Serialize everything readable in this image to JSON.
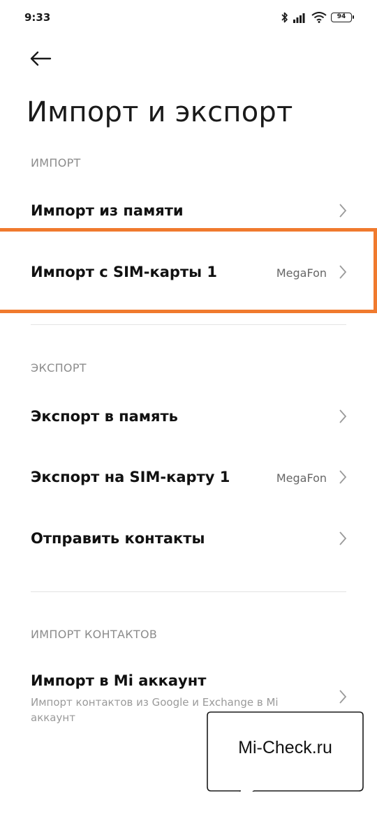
{
  "status_bar": {
    "time": "9:33",
    "battery": "94",
    "icons": [
      "bluetooth-icon",
      "signal-icon",
      "wifi-icon",
      "battery-icon"
    ]
  },
  "header": {
    "back_icon": "back-arrow-icon",
    "title": "Импорт и экспорт"
  },
  "sections": {
    "import": {
      "header": "ИМПОРТ",
      "items": [
        {
          "title": "Импорт из памяти"
        },
        {
          "title": "Импорт с SIM-карты 1",
          "value": "MegaFon"
        }
      ]
    },
    "export": {
      "header": "ЭКСПОРТ",
      "items": [
        {
          "title": "Экспорт в память"
        },
        {
          "title": "Экспорт на SIM-карту 1",
          "value": "MegaFon"
        },
        {
          "title": "Отправить контакты"
        }
      ]
    },
    "import_contacts": {
      "header": "ИМПОРТ КОНТАКТОВ",
      "items": [
        {
          "title": "Импорт в Mi аккаунт",
          "subtitle": "Импорт контактов из Google и Exchange в Mi аккаунт"
        }
      ]
    }
  },
  "highlight_color": "#f07a2e",
  "watermark": {
    "text": "Mi-Check.ru"
  }
}
